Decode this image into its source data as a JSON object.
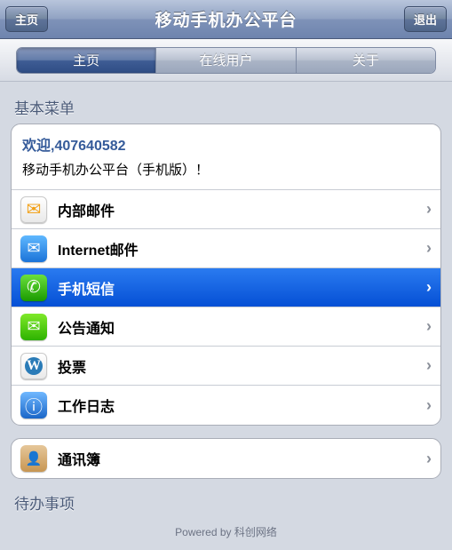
{
  "nav": {
    "title": "移动手机办公平台",
    "home_btn": "主页",
    "exit_btn": "退出"
  },
  "tabs": {
    "home": "主页",
    "online_users": "在线用户",
    "about": "关于"
  },
  "sections": {
    "basic_menu": "基本菜单",
    "todo": "待办事项"
  },
  "welcome": {
    "greeting": "欢迎,407640582",
    "subtitle": "移动手机办公平台（手机版）！"
  },
  "menu": {
    "internal_mail": "内部邮件",
    "internet_mail": "Internet邮件",
    "sms": "手机短信",
    "notice": "公告通知",
    "vote": "投票",
    "worklog": "工作日志",
    "contacts": "通讯簿"
  },
  "footer": {
    "powered": "Powered by ",
    "brand": "科创网络"
  }
}
